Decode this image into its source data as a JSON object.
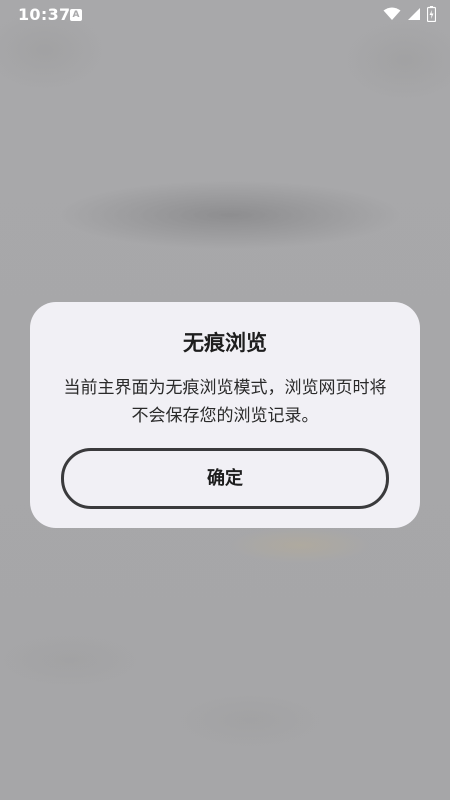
{
  "status_bar": {
    "time": "10:37",
    "notification_icon": "a-icon",
    "icons": [
      "wifi-icon",
      "cellular-signal-icon",
      "battery-charging-icon"
    ]
  },
  "dialog": {
    "title": "无痕浏览",
    "message": "当前主界面为无痕浏览模式，浏览网页时将不会保存您的浏览记录。",
    "confirm_label": "确定"
  },
  "colors": {
    "scrim": "#a8a8aa",
    "dialog_background": "#f1f0f5",
    "button_border": "#3a3a3c",
    "text": "#1e1e1e"
  }
}
